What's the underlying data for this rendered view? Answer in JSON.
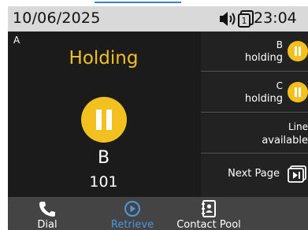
{
  "status": {
    "date": "10/06/2025",
    "time": "23:04",
    "line_indicator": "1",
    "icons": [
      "speaker-icon",
      "line-indicator-icon"
    ]
  },
  "call": {
    "line_label": "A",
    "state": "Holding",
    "name": "B",
    "number": "101"
  },
  "line_keys": [
    {
      "line1": "B",
      "line2": "holding",
      "icon": "hold-icon"
    },
    {
      "line1": "C",
      "line2": "holding",
      "icon": "hold-icon"
    },
    {
      "line1": "Line",
      "line2": "available"
    },
    {
      "line1": "Next Page",
      "icon": "next-page-icon"
    }
  ],
  "softkeys": [
    {
      "label": "Dial",
      "icon": "phone-icon"
    },
    {
      "label": "Retrieve",
      "icon": "play-icon"
    },
    {
      "label": "Contact Pool",
      "icon": "contact-book-icon"
    }
  ],
  "colors": {
    "accent": "#f2c01f",
    "active_softkey": "#4e96e0",
    "background": "#1b1b1b",
    "statusbar": "#d9d9d9"
  }
}
